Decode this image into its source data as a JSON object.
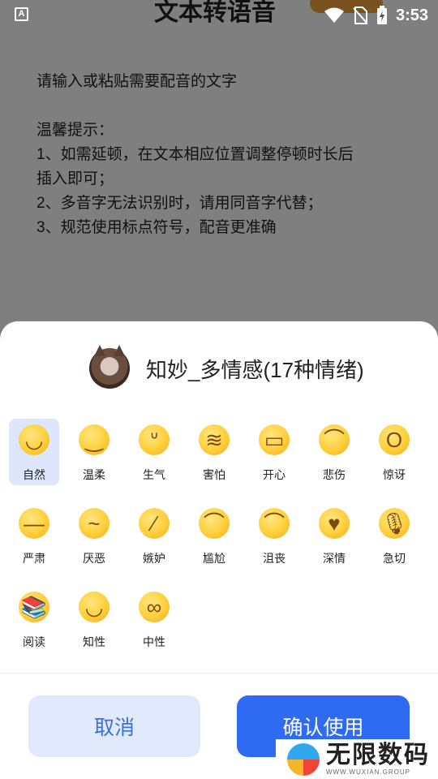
{
  "status_bar": {
    "time": "3:53",
    "icons": [
      "notification-a-icon",
      "wifi-icon",
      "no-sim-icon",
      "battery-charging-icon"
    ]
  },
  "page": {
    "title": "文本转语音",
    "textarea": {
      "placeholder": "请输入或粘贴需要配音的文字",
      "tips_title": "温馨提示：",
      "tips": [
        "1、如需延顿，在文本相应位置调整停顿时长后",
        "插入即可；",
        "2、多音字无法识别时，请用同音字代替；",
        "3、规范使用标点符号，配音更准确"
      ]
    }
  },
  "sheet": {
    "voice_name": "知妙_多情感(17种情绪)",
    "emotions": [
      {
        "label": "自然",
        "icon": "slight-smile-icon",
        "glyph": "◡",
        "selected": true
      },
      {
        "label": "温柔",
        "icon": "relaxed-face-icon",
        "glyph": "‿"
      },
      {
        "label": "生气",
        "icon": "steam-nose-face-icon",
        "glyph": "ᐡ"
      },
      {
        "label": "害怕",
        "icon": "confounded-face-icon",
        "glyph": "≋"
      },
      {
        "label": "开心",
        "icon": "grinning-face-icon",
        "glyph": "▭"
      },
      {
        "label": "悲伤",
        "icon": "frowning-face-icon",
        "glyph": "⌒"
      },
      {
        "label": "惊讶",
        "icon": "screaming-face-icon",
        "glyph": "O"
      },
      {
        "label": "严肃",
        "icon": "neutral-face-icon",
        "glyph": "—"
      },
      {
        "label": "厌恶",
        "icon": "thinking-face-icon",
        "glyph": "~"
      },
      {
        "label": "嫉妒",
        "icon": "confused-face-icon",
        "glyph": "∕"
      },
      {
        "label": "尴尬",
        "icon": "anxious-sweat-face-icon",
        "glyph": "⌒"
      },
      {
        "label": "沮丧",
        "icon": "crying-face-icon",
        "glyph": "⌒"
      },
      {
        "label": "深情",
        "icon": "smiling-hearts-face-icon",
        "glyph": "♥"
      },
      {
        "label": "急切",
        "icon": "microphone-icon",
        "glyph": "🎙"
      },
      {
        "label": "阅读",
        "icon": "books-icon",
        "glyph": "📚"
      },
      {
        "label": "知性",
        "icon": "woman-icon",
        "glyph": "◡"
      },
      {
        "label": "中性",
        "icon": "nerd-face-icon",
        "glyph": "∞"
      }
    ],
    "cancel_label": "取消",
    "confirm_label": "确认使用"
  },
  "watermark": {
    "main": "无限数码",
    "sub": "WWW.WUXIAN.GROUP"
  },
  "colors": {
    "accent": "#2f6bf2",
    "cancel_bg": "#e1eafc",
    "selected_bg": "#dde6fb"
  }
}
